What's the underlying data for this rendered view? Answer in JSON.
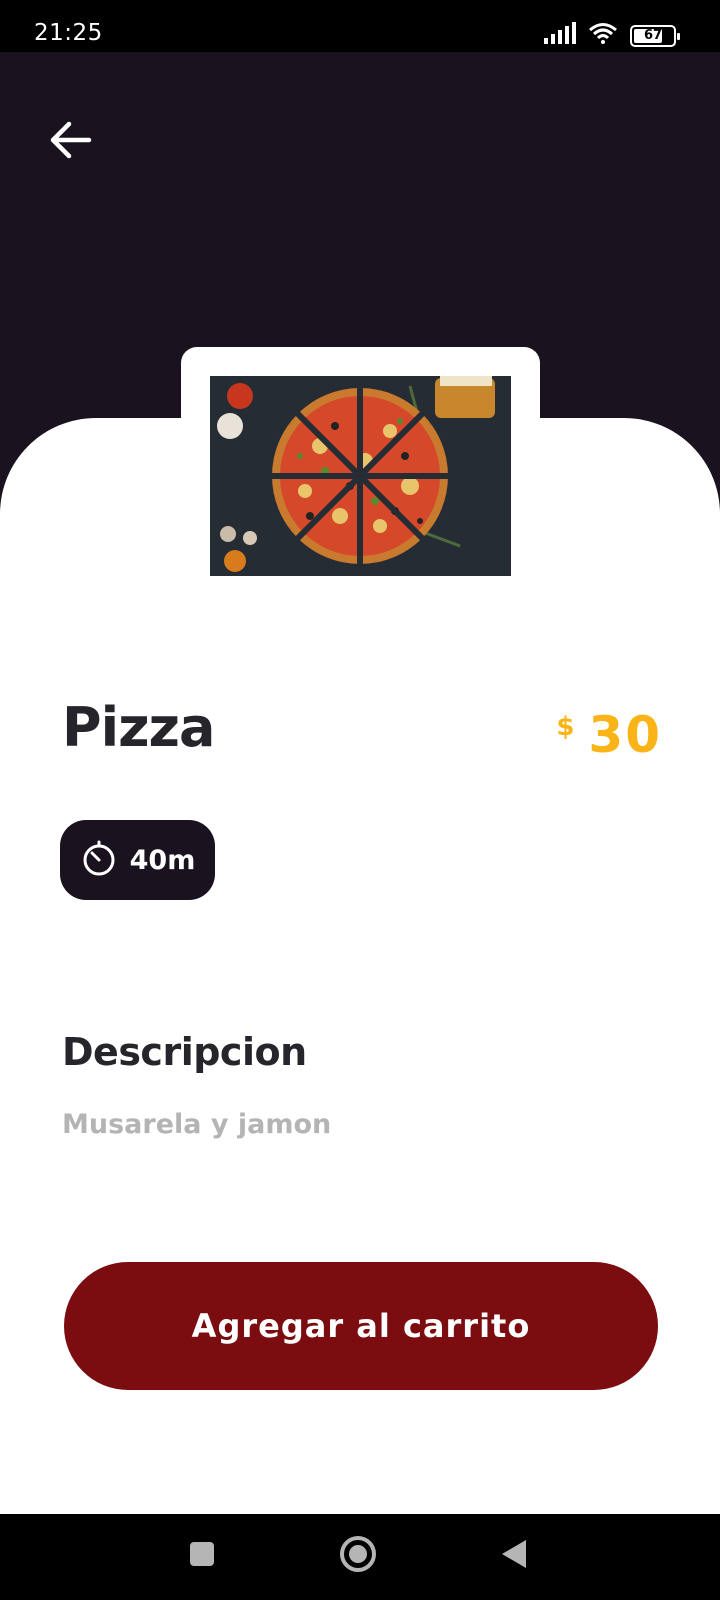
{
  "status_bar": {
    "time": "21:25",
    "battery": "67",
    "icons": [
      "signal-icon",
      "wifi-icon",
      "battery-icon"
    ]
  },
  "header": {
    "back_icon": "arrow-left-icon",
    "background_color": "#1a121e"
  },
  "product": {
    "name": "Pizza",
    "currency": "$",
    "price": "30",
    "prep_time": "40m",
    "timer_icon": "timer-icon",
    "image": "pizza-photo"
  },
  "description": {
    "title": "Descripcion",
    "text": "Musarela y jamon"
  },
  "actions": {
    "add_to_cart": "Agregar al carrito"
  },
  "nav_bar": {
    "icons": [
      "recents-square-icon",
      "home-circle-icon",
      "back-triangle-icon"
    ]
  },
  "colors": {
    "dark": "#1a121e",
    "accent_price": "#fbb418",
    "button": "#7b0c10",
    "muted_text": "#b4b4b4"
  }
}
